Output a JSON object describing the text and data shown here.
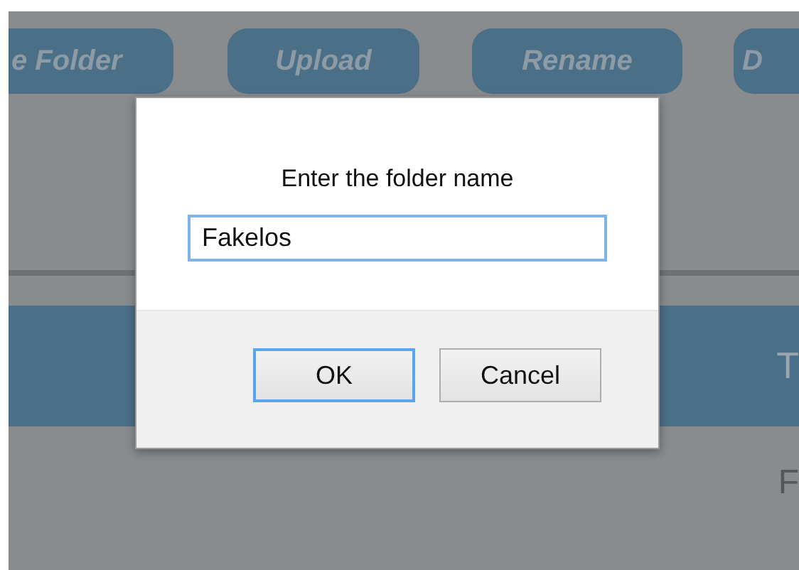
{
  "toolbar": {
    "buttons": [
      {
        "label": "e Folder"
      },
      {
        "label": "Upload"
      },
      {
        "label": "Rename"
      },
      {
        "label": "D"
      }
    ]
  },
  "banner": {
    "text": "T"
  },
  "content": {
    "text": "F"
  },
  "dialog": {
    "prompt": "Enter the folder name",
    "input": {
      "value": "Fakelos"
    },
    "buttons": [
      {
        "label": "OK",
        "focused": true
      },
      {
        "label": "Cancel",
        "focused": false
      }
    ]
  }
}
